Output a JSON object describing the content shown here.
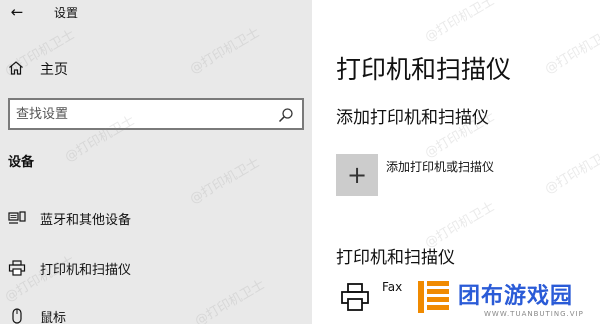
{
  "window": {
    "back_glyph": "←",
    "title": "设置"
  },
  "sidebar": {
    "home": {
      "label": "主页",
      "icon": "home-icon"
    },
    "search": {
      "placeholder": "查找设置",
      "icon": "search-icon"
    },
    "section_header": "设备",
    "items": [
      {
        "label": "蓝牙和其他设备",
        "icon": "bluetooth-devices-icon"
      },
      {
        "label": "打印机和扫描仪",
        "icon": "printer-icon"
      },
      {
        "label": "鼠标",
        "icon": "mouse-icon"
      }
    ]
  },
  "main": {
    "title": "打印机和扫描仪",
    "add_heading": "添加打印机和扫描仪",
    "add_button": {
      "glyph": "+",
      "label": "添加打印机或扫描仪"
    },
    "list_heading": "打印机和扫描仪",
    "printers": [
      {
        "name": "Fax"
      }
    ]
  },
  "brand": {
    "name": "团布游戏园",
    "sub": "WWW.TUANBUTING.VIP"
  },
  "watermark": "@打印机卫士",
  "colors": {
    "sidebar_bg": "#e9e9e9",
    "tile_bg": "#cccccc",
    "brand_blue": "#2a5bd7",
    "brand_orange": "#f08a00"
  }
}
